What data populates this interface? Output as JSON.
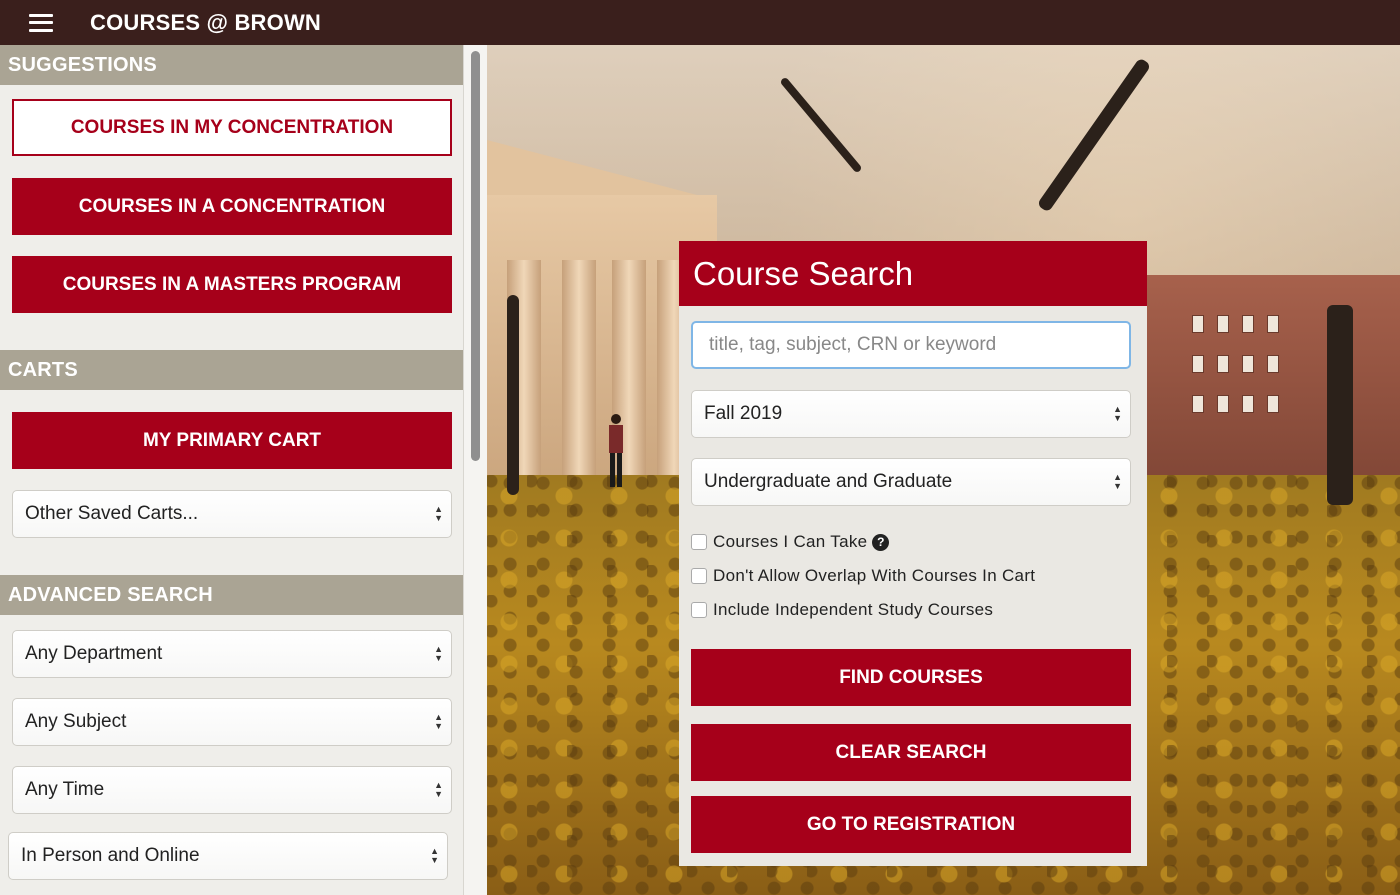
{
  "header": {
    "menu_icon": "hamburger-icon",
    "title": "COURSES @ BROWN"
  },
  "colors": {
    "brand_red": "#a6001a",
    "topbar": "#3a1f1c",
    "section_header": "#aaa494",
    "focus_border": "#7fb6e6"
  },
  "sidebar": {
    "suggestions": {
      "heading": "SUGGESTIONS",
      "buttons": [
        "COURSES IN MY CONCENTRATION",
        "COURSES IN A CONCENTRATION",
        "COURSES IN A MASTERS PROGRAM"
      ]
    },
    "carts": {
      "heading": "CARTS",
      "primary_button": "MY PRIMARY CART",
      "other_carts_select": "Other Saved Carts..."
    },
    "advanced_search": {
      "heading": "ADVANCED SEARCH",
      "department_select": "Any Department",
      "subject_select": "Any Subject",
      "time_select": "Any Time",
      "mode_select": "In Person and Online"
    }
  },
  "course_search": {
    "title": "Course Search",
    "search_placeholder": "title, tag, subject, CRN or keyword",
    "term_select": "Fall 2019",
    "level_select": "Undergraduate and Graduate",
    "checkboxes": [
      "Courses I Can Take",
      "Don't Allow Overlap With Courses In Cart",
      "Include Independent Study Courses"
    ],
    "help_icon": "question-circle-icon",
    "find_button": "FIND COURSES",
    "clear_button": "CLEAR SEARCH",
    "registration_button": "GO TO REGISTRATION"
  }
}
